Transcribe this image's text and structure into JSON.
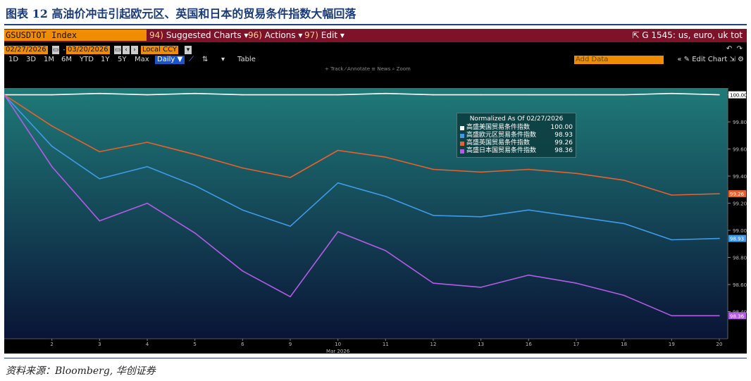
{
  "figure_title": "图表 12 高油价冲击引起欧元区、英国和日本的贸易条件指数大幅回落",
  "source": "资料来源：Bloomberg, 华创证券",
  "toolbar": {
    "ticker": "GSUSDTOT Index",
    "menus": [
      {
        "num": "94)",
        "label": "Suggested Charts ▾"
      },
      {
        "num": "96)",
        "label": "Actions ▾"
      },
      {
        "num": "97)",
        "label": "Edit ▾"
      }
    ],
    "right_label": "G 1545: us, euro, uk tot",
    "start_date": "02/27/2026",
    "end_date": "03/20/2026",
    "currency": "Local CCY",
    "ranges": [
      "1D",
      "3D",
      "1M",
      "6M",
      "YTD",
      "1Y",
      "5Y",
      "Max"
    ],
    "frequency": "Daily ▼",
    "table_label": "Table",
    "add_data_placeholder": "Add Data",
    "edit_chart_label": "« ✎ Edit Chart",
    "chart_tools": "+ Track  ⁄ Annotate  ≡ News  ⌕ Zoom"
  },
  "colors": {
    "us": "#ffffff",
    "euro": "#3f9be8",
    "uk": "#e8602c",
    "japan": "#b45ce8",
    "bg_top": "#1f7a78",
    "bg_bottom": "#0a1436"
  },
  "chart_data": {
    "type": "line",
    "title": "",
    "xlabel": "Mar 2026",
    "ylabel": "",
    "x": [
      "2026-02-27",
      "2026-03-02",
      "2026-03-03",
      "2026-03-04",
      "2026-03-05",
      "2026-03-06",
      "2026-03-09",
      "2026-03-10",
      "2026-03-11",
      "2026-03-12",
      "2026-03-13",
      "2026-03-16",
      "2026-03-17",
      "2026-03-18",
      "2026-03-19",
      "2026-03-20"
    ],
    "x_tick_labels": [
      "2",
      "3",
      "4",
      "5",
      "6",
      "9",
      "10",
      "11",
      "12",
      "13",
      "16",
      "17",
      "18",
      "19",
      "20"
    ],
    "ylim": [
      98.2,
      100.05
    ],
    "y_ticks": [
      98.4,
      98.6,
      98.8,
      99.0,
      99.2,
      99.4,
      99.6,
      99.8,
      100.0
    ],
    "y_tick_labels": [
      "98.40",
      "98.60",
      "98.80",
      "99.00",
      "99.20",
      "99.40",
      "99.60",
      "99.80",
      "100.00"
    ],
    "legend_title": "Normalized As Of 02/27/2026",
    "series": [
      {
        "name": "高盛美国贸易条件指数",
        "key": "us",
        "last": "100.00",
        "last_label": "100.00",
        "values": [
          100.0,
          100.0,
          100.01,
          100.0,
          100.01,
          100.0,
          100.0,
          100.0,
          100.01,
          100.0,
          100.0,
          100.0,
          100.0,
          100.0,
          100.01,
          100.0
        ]
      },
      {
        "name": "高盛欧元区贸易条件指数",
        "key": "euro",
        "last": "98.93",
        "last_label": "98.93",
        "values": [
          100.0,
          99.62,
          99.38,
          99.47,
          99.33,
          99.15,
          99.03,
          99.35,
          99.25,
          99.11,
          99.1,
          99.15,
          99.1,
          99.05,
          98.93,
          98.94
        ]
      },
      {
        "name": "高盛英国贸易条件指数",
        "key": "uk",
        "last": "99.26",
        "last_label": "99.26",
        "values": [
          100.0,
          99.77,
          99.58,
          99.65,
          99.56,
          99.46,
          99.39,
          99.59,
          99.54,
          99.45,
          99.43,
          99.45,
          99.42,
          99.37,
          99.26,
          99.27
        ]
      },
      {
        "name": "高盛日本国贸易条件指数",
        "key": "japan",
        "last": "98.36",
        "last_label": "98.36",
        "values": [
          100.0,
          99.47,
          99.07,
          99.2,
          98.98,
          98.7,
          98.51,
          98.99,
          98.85,
          98.61,
          98.58,
          98.67,
          98.61,
          98.52,
          98.37,
          98.37
        ]
      }
    ]
  }
}
